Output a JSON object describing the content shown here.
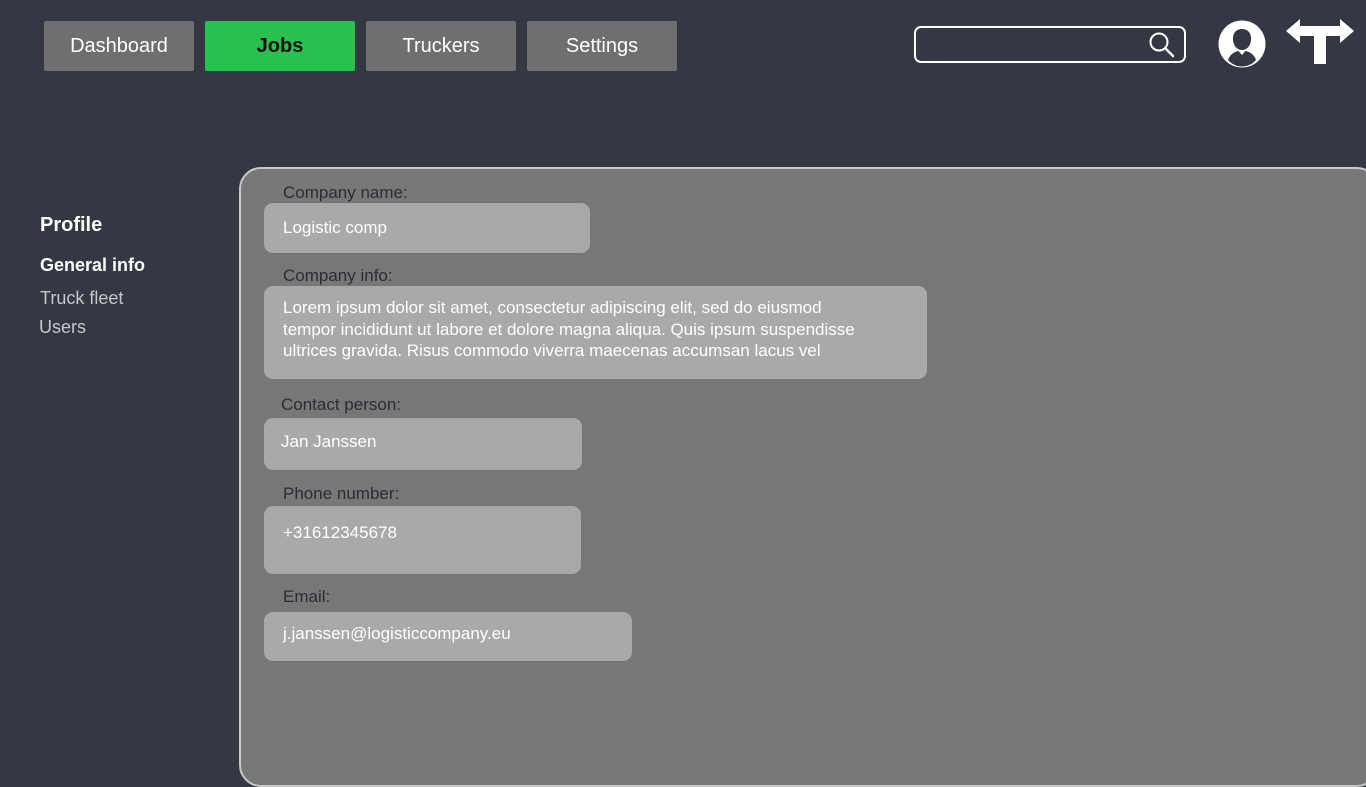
{
  "nav": {
    "items": [
      {
        "label": "Dashboard",
        "active": false
      },
      {
        "label": "Jobs",
        "active": true
      },
      {
        "label": "Truckers",
        "active": false
      },
      {
        "label": "Settings",
        "active": false
      }
    ]
  },
  "header": {
    "search_value": "",
    "icons": [
      "search-icon",
      "avatar-icon",
      "logout-icon"
    ]
  },
  "colors": {
    "background": "#353842",
    "nav_button": "#6f6f6f",
    "nav_active": "#28c14f",
    "panel": "#777777",
    "field": "#a9a9a9"
  },
  "sidebar": {
    "title": "Profile",
    "items": [
      {
        "label": "General info",
        "active": true
      },
      {
        "label": "Truck fleet",
        "active": false
      },
      {
        "label": "Users",
        "active": false
      }
    ]
  },
  "form": {
    "company_name": {
      "label": "Company name:",
      "value": "Logistic comp"
    },
    "company_info": {
      "label": "Company info:",
      "lines": [
        "Lorem ipsum dolor sit amet, consectetur adipiscing elit, sed do eiusmod",
        "tempor incididunt ut labore et dolore magna aliqua. Quis ipsum suspendisse",
        "ultrices gravida. Risus commodo viverra maecenas accumsan lacus vel"
      ]
    },
    "contact_person": {
      "label": "Contact person:",
      "value": "Jan Janssen"
    },
    "phone_number": {
      "label": "Phone number:",
      "value": "+31612345678"
    },
    "email": {
      "label": "Email:",
      "value": "j.janssen@logisticcompany.eu"
    }
  }
}
